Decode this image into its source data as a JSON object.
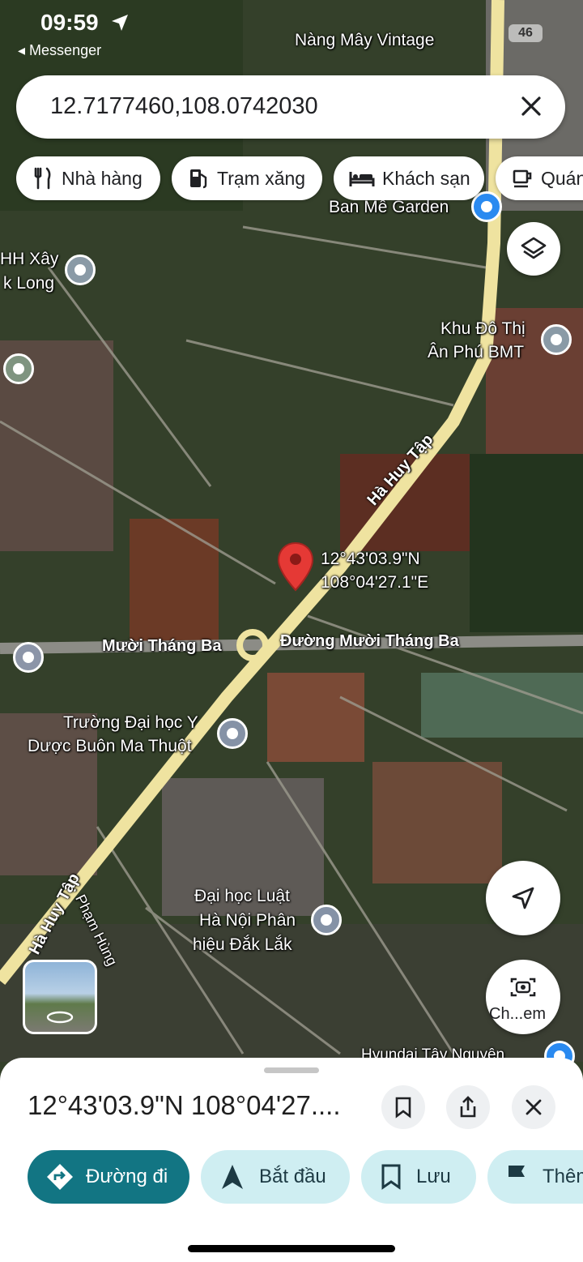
{
  "status": {
    "time": "09:59",
    "back_app": "Messenger",
    "battery": "46"
  },
  "search": {
    "query": "12.7177460,108.0742030"
  },
  "chips": [
    {
      "label": "Nhà hàng",
      "icon": "fork-knife-icon"
    },
    {
      "label": "Trạm xăng",
      "icon": "gas-station-icon"
    },
    {
      "label": "Khách sạn",
      "icon": "bed-icon"
    },
    {
      "label": "Quán",
      "icon": "coffee-cup-icon"
    }
  ],
  "map": {
    "labels": {
      "nang_may": "Nàng Mây Vintage",
      "ban_me_garden": "Ban Mê Garden",
      "xay_dak_1": "HH Xây",
      "xay_dak_2": "k Long",
      "khu_do_thi_1": "Khu Đô Thị",
      "khu_do_thi_2": "Ân Phú BMT",
      "ha_huy_tap_1": "Hà Huy Tập",
      "ha_huy_tap_2": "Hà Huy Tập",
      "pin_lat": "12°43'03.9\"N",
      "pin_lng": "108°04'27.1\"E",
      "muoi_thang_ba": "Mười Tháng Ba",
      "duong_muoi_thang_ba": "Đường Mười Tháng Ba",
      "dai_hoc_y_1": "Trường Đại học Y",
      "dai_hoc_y_2": "Dược Buôn Ma Thuột",
      "dai_hoc_luat_1": "Đại học Luật",
      "dai_hoc_luat_2": "Hà Nội Phân",
      "dai_hoc_luat_3": "hiệu Đắk Lắk",
      "pham_hung": "Phạm Hùng",
      "hyundai": "Hyundai Tây Nguyên",
      "camera_label": "Ch...em"
    }
  },
  "sheet": {
    "title": "12°43'03.9\"N 108°04'27....",
    "actions": [
      {
        "label": "Đường đi",
        "icon": "directions-icon"
      },
      {
        "label": "Bắt đầu",
        "icon": "navigation-arrow-icon"
      },
      {
        "label": "Lưu",
        "icon": "bookmark-icon"
      },
      {
        "label": "Thêm",
        "icon": "flag-icon"
      }
    ]
  },
  "colors": {
    "accent": "#127583",
    "chip_light": "#cfeef2",
    "pin": "#e53935",
    "road": "#efe3a0"
  }
}
